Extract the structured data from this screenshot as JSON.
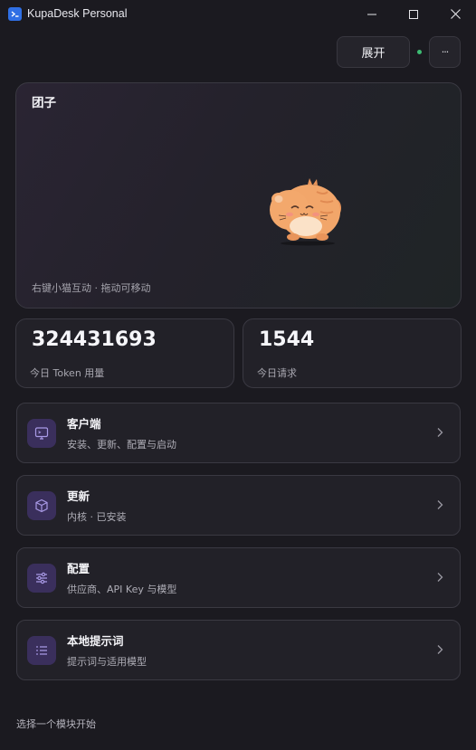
{
  "window": {
    "title": "KupaDesk Personal"
  },
  "header": {
    "expand_label": "展开",
    "more_label": "···",
    "status_color": "#3dbb72"
  },
  "pet": {
    "name": "团子",
    "hint": "右键小猫互动 · 拖动可移动"
  },
  "stats": {
    "tokens_value": "324431693",
    "tokens_label": "今日 Token 用量",
    "requests_value": "1544",
    "requests_label": "今日请求"
  },
  "modules": [
    {
      "title": "客户端",
      "desc": "安装、更新、配置与启动",
      "icon": "monitor-icon"
    },
    {
      "title": "更新",
      "desc": "内核 · 已安装",
      "icon": "package-icon"
    },
    {
      "title": "配置",
      "desc": "供应商、API Key 与模型",
      "icon": "sliders-icon"
    },
    {
      "title": "本地提示词",
      "desc": "提示词与适用模型",
      "icon": "list-icon"
    }
  ],
  "footer": {
    "hint": "选择一个模块开始"
  },
  "colors": {
    "accent": "#7b68c9",
    "icon_bg": "#3a2f5c",
    "app_icon": "#2f6fe4"
  }
}
